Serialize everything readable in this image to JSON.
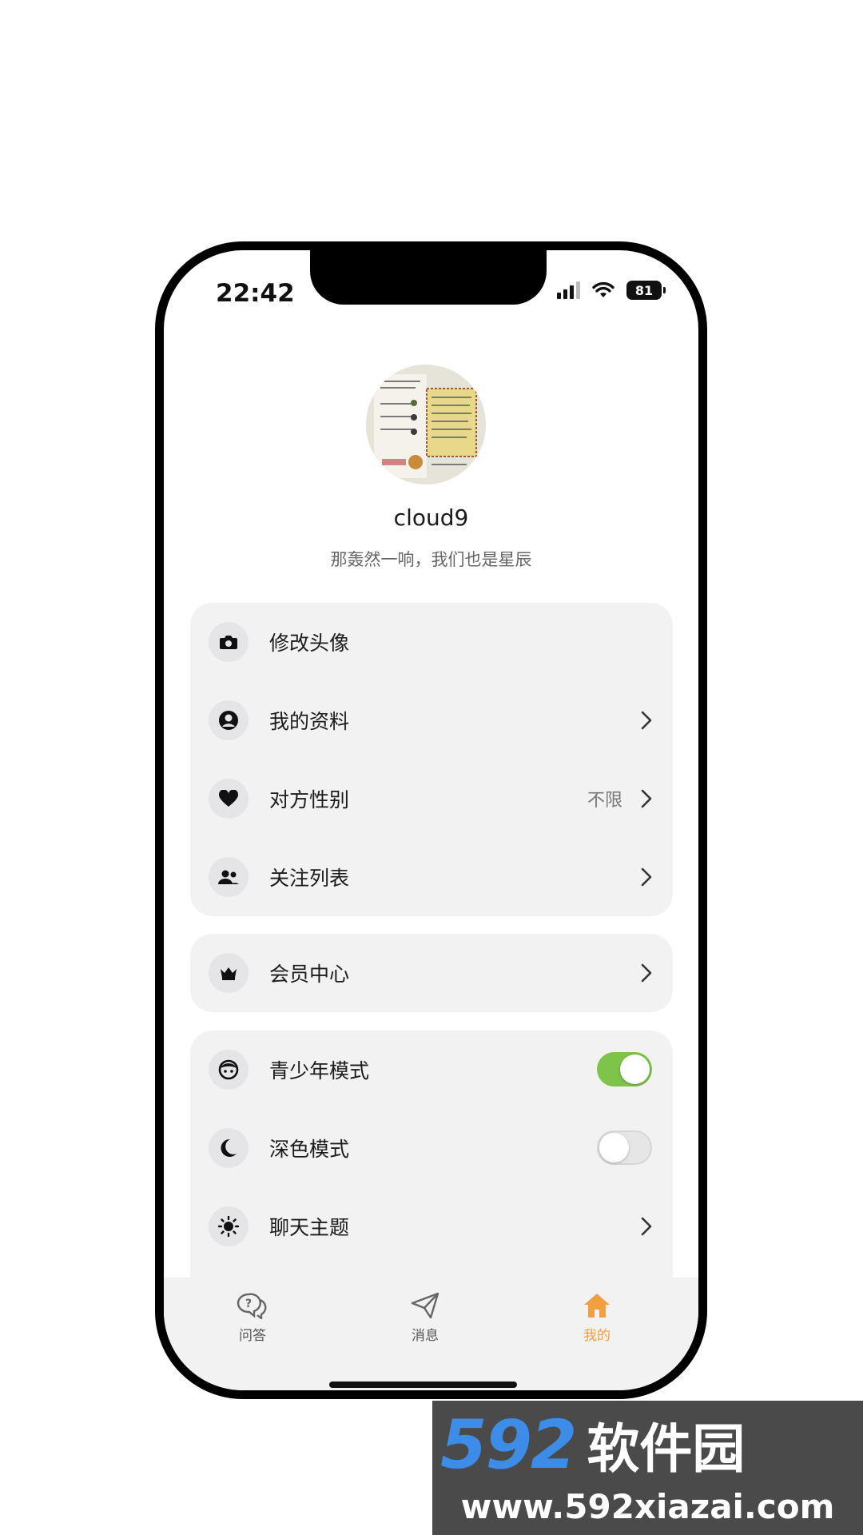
{
  "status_bar": {
    "time": "22:42",
    "battery": "81"
  },
  "profile": {
    "username": "cloud9",
    "signature": "那轰然一响，我们也是星辰"
  },
  "menu_group_1": [
    {
      "icon": "camera-icon",
      "label": "修改头像",
      "value": "",
      "chevron": false
    },
    {
      "icon": "user-circle-icon",
      "label": "我的资料",
      "value": "",
      "chevron": true
    },
    {
      "icon": "heart-icon",
      "label": "对方性别",
      "value": "不限",
      "chevron": true
    },
    {
      "icon": "people-icon",
      "label": "关注列表",
      "value": "",
      "chevron": true
    }
  ],
  "menu_group_2": [
    {
      "icon": "crown-icon",
      "label": "会员中心",
      "chevron": true
    }
  ],
  "menu_group_3": [
    {
      "icon": "face-icon",
      "label": "青少年模式",
      "toggle": true,
      "on": true
    },
    {
      "icon": "moon-icon",
      "label": "深色模式",
      "toggle": true,
      "on": false
    },
    {
      "icon": "sun-icon",
      "label": "聊天主题",
      "chevron": true
    }
  ],
  "tabbar": [
    {
      "icon": "question-chat-icon",
      "label": "问答",
      "active": false
    },
    {
      "icon": "paper-plane-icon",
      "label": "消息",
      "active": false
    },
    {
      "icon": "home-icon",
      "label": "我的",
      "active": true
    }
  ],
  "colors": {
    "accent": "#f0a040",
    "toggle_on": "#7ec34a",
    "card_bg": "#f2f2f2"
  },
  "watermark": {
    "logo_number": "592",
    "logo_text": "软件园",
    "url": "www.592xiazai.com"
  }
}
